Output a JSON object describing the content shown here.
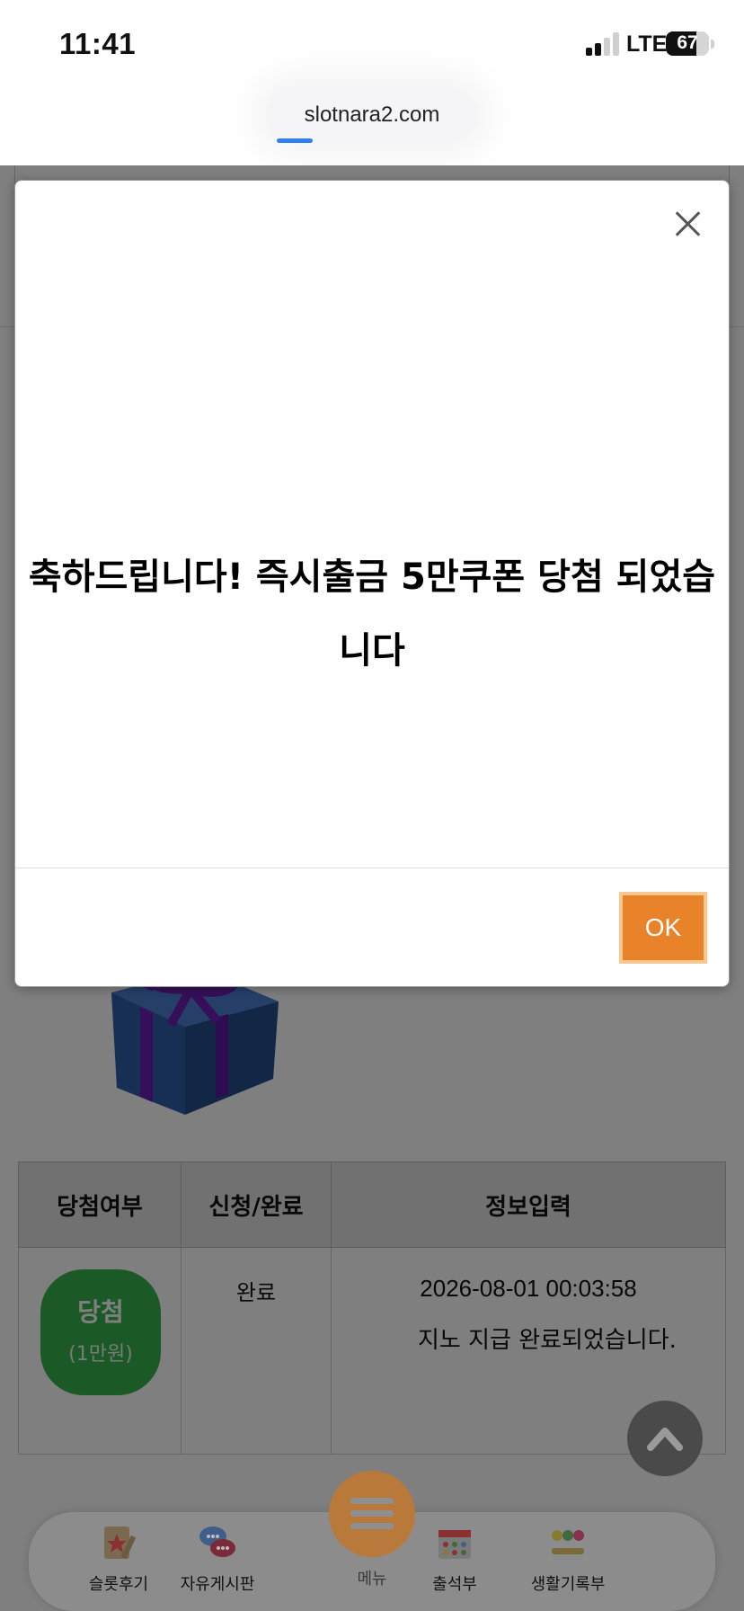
{
  "status": {
    "time": "11:41",
    "network": "LTE",
    "battery": "67"
  },
  "browser": {
    "url": "slotnara2.com"
  },
  "modal": {
    "message": "축하드립니다! 즉시출금 5만쿠폰 당첨 되었습니다",
    "ok_label": "OK"
  },
  "table": {
    "headers": [
      "당첨여부",
      "신청/완료",
      "정보입력"
    ],
    "rows": [
      {
        "status_badge": "당첨",
        "status_sub": "(1만원)",
        "apply": "완료",
        "date": "2026-08-01 00:03:58",
        "info": "지노 지급 완료되었습니다."
      }
    ]
  },
  "bottom_nav": {
    "items": [
      {
        "label": "슬롯후기"
      },
      {
        "label": "자유게시판"
      },
      {
        "label": "메뉴"
      },
      {
        "label": "출석부"
      },
      {
        "label": "생활기록부"
      }
    ]
  },
  "colors": {
    "ok_button": "#e8832a",
    "badge_green": "#37b24d",
    "menu_fab": "#e8832a",
    "gift_box": "#2f5fa8",
    "ribbon": "#6a1fb3"
  }
}
